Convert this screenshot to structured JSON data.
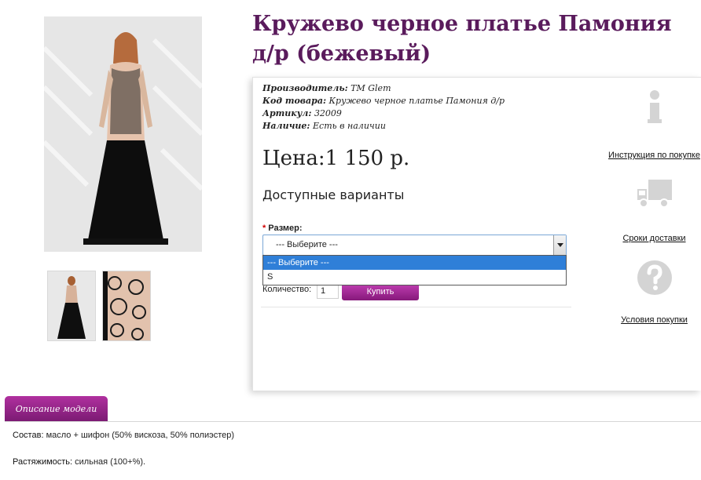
{
  "product": {
    "title": "Кружево черное платье Памония д/р (бежевый)",
    "manufacturer_label": "Производитель:",
    "manufacturer": "TM Glem",
    "code_label": "Код товара:",
    "code": "Кружево черное платье Памония д/р",
    "article_label": "Артикул:",
    "article": "32009",
    "availability_label": "Наличие:",
    "availability": "Есть в наличии",
    "price": "Цена:1 150 р."
  },
  "options": {
    "heading": "Доступные варианты",
    "size_label": "Размер:",
    "size_required_mark": "*",
    "select_value": "--- Выберите ---",
    "dropdown_options": [
      "--- Выберите ---",
      "S"
    ],
    "quantity_label": "Количество:",
    "quantity_value": "1",
    "buy_label": "Купить"
  },
  "side": {
    "instruction_label": "Инструкция по покупке",
    "delivery_label": "Сроки доставки",
    "conditions_label": "Условия покупки"
  },
  "description": {
    "tab_label": "Описание модели",
    "composition_label": "Состав:",
    "composition": "масло + шифон (50% вискоза, 50% полиэстер)",
    "stretch_label": "Растяжимость:",
    "stretch": "сильная (100+%)."
  },
  "colors": {
    "title": "#5a1b5c",
    "accent": "#a0268f",
    "selected_option": "#2f7fd8",
    "icon_gray": "#d4d4d4"
  }
}
